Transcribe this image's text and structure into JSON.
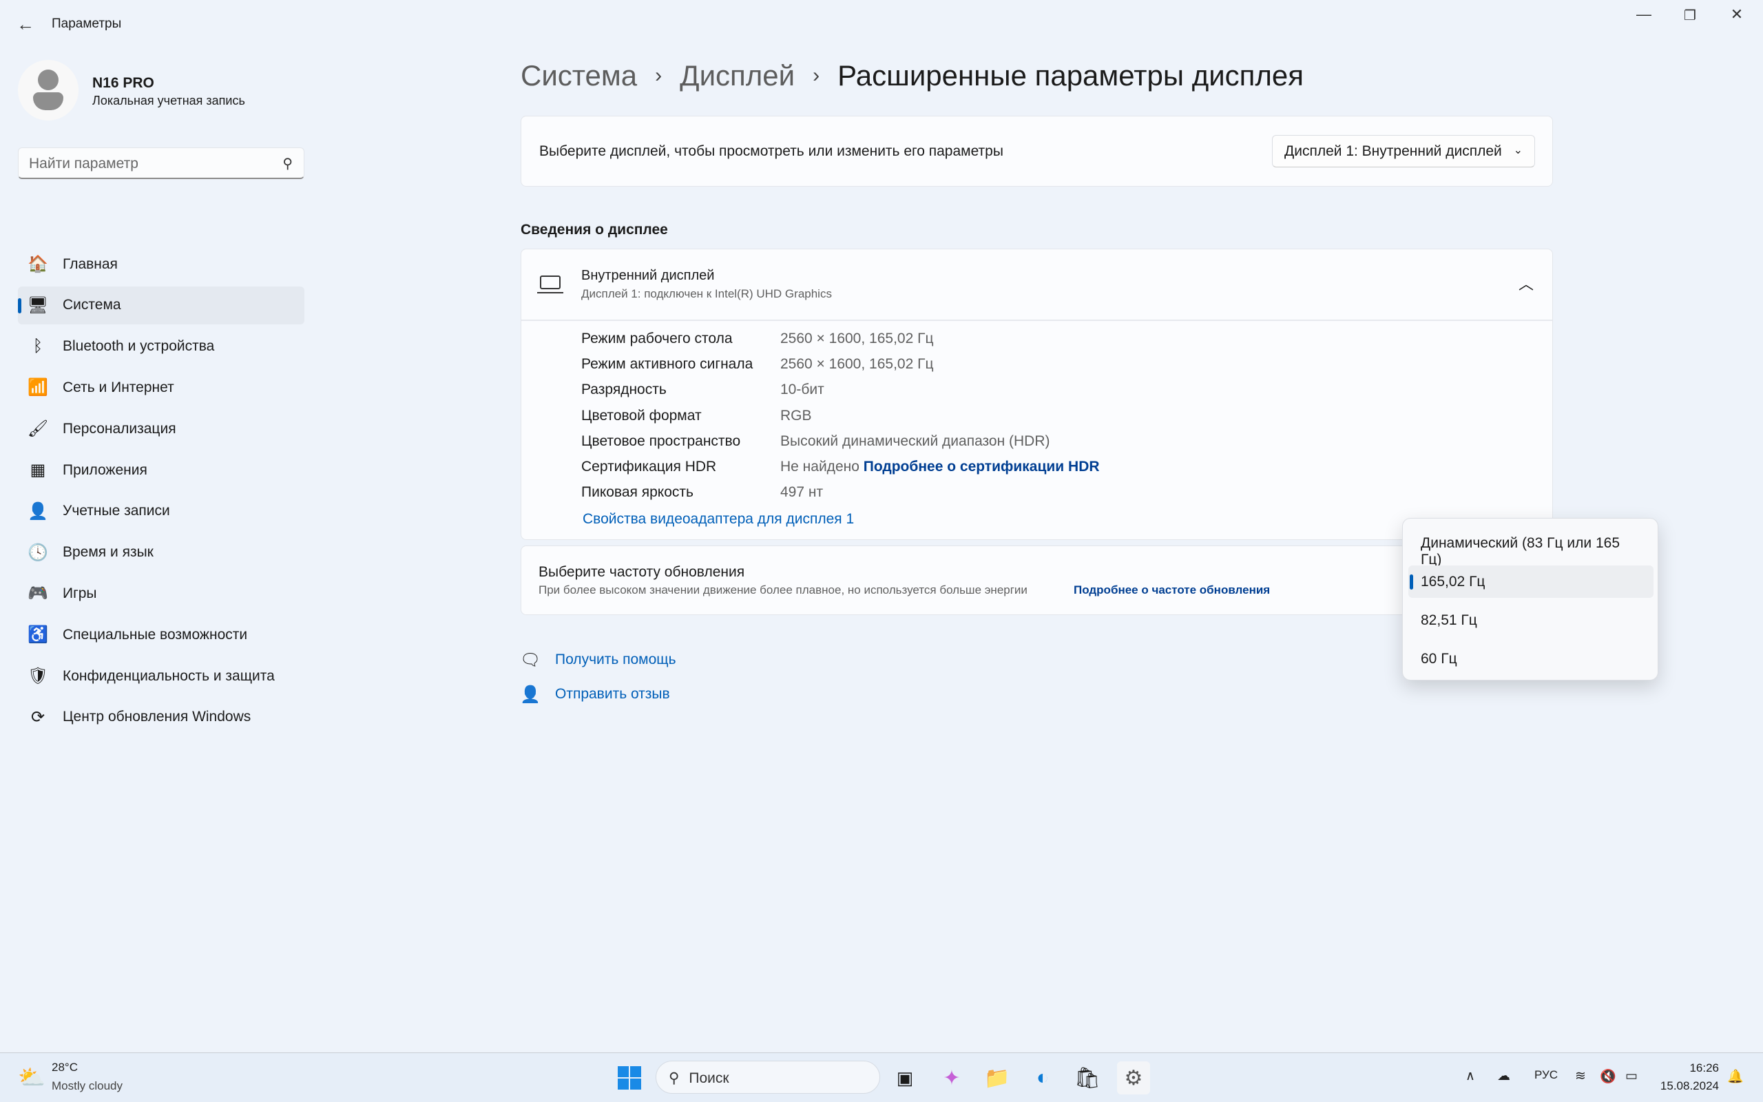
{
  "window": {
    "title": "Параметры",
    "back_icon": "arrow-left",
    "controls": [
      "minimize",
      "restore",
      "close"
    ]
  },
  "user": {
    "name": "N16 PRO",
    "account": "Локальная учетная запись"
  },
  "search": {
    "placeholder": "Найти параметр"
  },
  "sidebar": {
    "items": [
      {
        "label": "Главная",
        "icon": "home-icon",
        "glyph": "🏠"
      },
      {
        "label": "Система",
        "icon": "system-icon",
        "glyph": "🖥",
        "selected": true
      },
      {
        "label": "Bluetooth и устройства",
        "icon": "bluetooth-icon",
        "glyph": "ᛒ"
      },
      {
        "label": "Сеть и Интернет",
        "icon": "wifi-icon",
        "glyph": "📶"
      },
      {
        "label": "Персонализация",
        "icon": "brush-icon",
        "glyph": "🖌"
      },
      {
        "label": "Приложения",
        "icon": "apps-icon",
        "glyph": "▦"
      },
      {
        "label": "Учетные записи",
        "icon": "accounts-icon",
        "glyph": "👤"
      },
      {
        "label": "Время и язык",
        "icon": "time-language-icon",
        "glyph": "🕓"
      },
      {
        "label": "Игры",
        "icon": "gaming-icon",
        "glyph": "🎮"
      },
      {
        "label": "Специальные возможности",
        "icon": "accessibility-icon",
        "glyph": "♿"
      },
      {
        "label": "Конфиденциальность и защита",
        "icon": "shield-icon",
        "glyph": "🛡"
      },
      {
        "label": "Центр обновления Windows",
        "icon": "update-icon",
        "glyph": "⟳"
      }
    ]
  },
  "breadcrumb": {
    "items": [
      "Система",
      "Дисплей",
      "Расширенные параметры дисплея"
    ],
    "separator": "›"
  },
  "display_select": {
    "label": "Выберите дисплей, чтобы просмотреть или изменить его параметры",
    "value": "Дисплей 1: Внутренний дисплей"
  },
  "info": {
    "section_title": "Сведения о дисплее",
    "title": "Внутренний дисплей",
    "subtitle": "Дисплей 1: подключен к Intel(R) UHD Graphics",
    "rows": [
      {
        "label": "Режим рабочего стола",
        "value": "2560 × 1600, 165,02 Гц"
      },
      {
        "label": "Режим активного сигнала",
        "value": "2560 × 1600, 165,02 Гц"
      },
      {
        "label": "Разрядность",
        "value": "10-бит"
      },
      {
        "label": "Цветовой формат",
        "value": "RGB"
      },
      {
        "label": "Цветовое пространство",
        "value": "Высокий динамический диапазон (HDR)"
      },
      {
        "label": "Сертификация HDR",
        "value": "Не найдено",
        "link": "Подробнее о сертификации HDR"
      },
      {
        "label": "Пиковая яркость",
        "value": "497 нт"
      }
    ],
    "adapter_link": "Свойства видеоадаптера для дисплея 1"
  },
  "refresh": {
    "title": "Выберите частоту обновления",
    "description": "При более высоком значении движение более плавное, но используется больше энергии",
    "link": "Подробнее о частоте обновления",
    "options": [
      "Динамический (83 Гц или 165 Гц)",
      "165,02 Гц",
      "82,51 Гц",
      "60 Гц"
    ],
    "selected": "165,02 Гц"
  },
  "help": {
    "get_help": "Получить помощь",
    "feedback": "Отправить отзыв"
  },
  "taskbar": {
    "weather_temp": "28°C",
    "weather_desc": "Mostly cloudy",
    "search": "Поиск",
    "lang": "РУС",
    "time": "16:26",
    "date": "15.08.2024"
  },
  "colors": {
    "accent": "#005fb8",
    "link": "#003e92",
    "background": "#eef3fa"
  }
}
